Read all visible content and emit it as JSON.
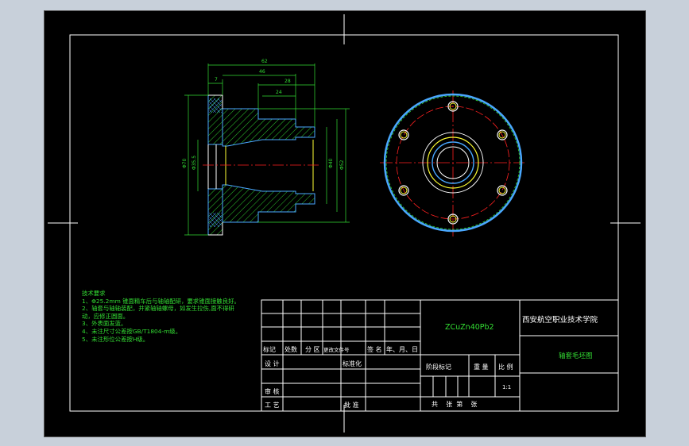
{
  "title_block": {
    "material": "ZCuZn40Pb2",
    "school": "西安航空职业技术学院",
    "drawing_name": "轴套毛坯图",
    "scale": "1:1",
    "rev_headers": [
      "标记",
      "处数",
      "分 区",
      "更改文件号",
      "签 名",
      "年、月、日"
    ],
    "label_design": "设 计",
    "label_standardize": "标准化",
    "label_review": "审 核",
    "label_process": "工 艺",
    "label_approve": "批 准",
    "stage_mark": "阶段标记",
    "weight": "重 量",
    "ratio": "比 例",
    "sheets": "共    张  第    张"
  },
  "tech_notes": {
    "heading": "技术要求",
    "items": [
      "1、Φ25.2mm 锥面精车后与轴轴配研，要求锥面接触良好。",
      "2、轴套与轴轴装配，并紧轴轴螺母，如发生拉伤,面不得研",
      "动，应修正圆面。",
      "3、外表面发蓝。",
      "4、未注尺寸公差按GB/T1804-m级。",
      "5、未注形位公差按H级。"
    ]
  },
  "dims": {
    "top_overall": "62",
    "second": "46",
    "third": "28",
    "fourth": "24",
    "small": "7",
    "left_a": "Φ70",
    "left_b": "Φ35.5",
    "right_a": "Φ40",
    "right_b": "Φ52"
  },
  "colors": {
    "background": "#000000",
    "frame": "#ffffff",
    "hatch": "#33dd33",
    "dimension": "#33dd33",
    "centerline": "#ff2020",
    "hidden": "#ffff33",
    "outline_blue": "#4aa8ff",
    "title_text": "#ffffff",
    "material_text": "#33dd33"
  }
}
